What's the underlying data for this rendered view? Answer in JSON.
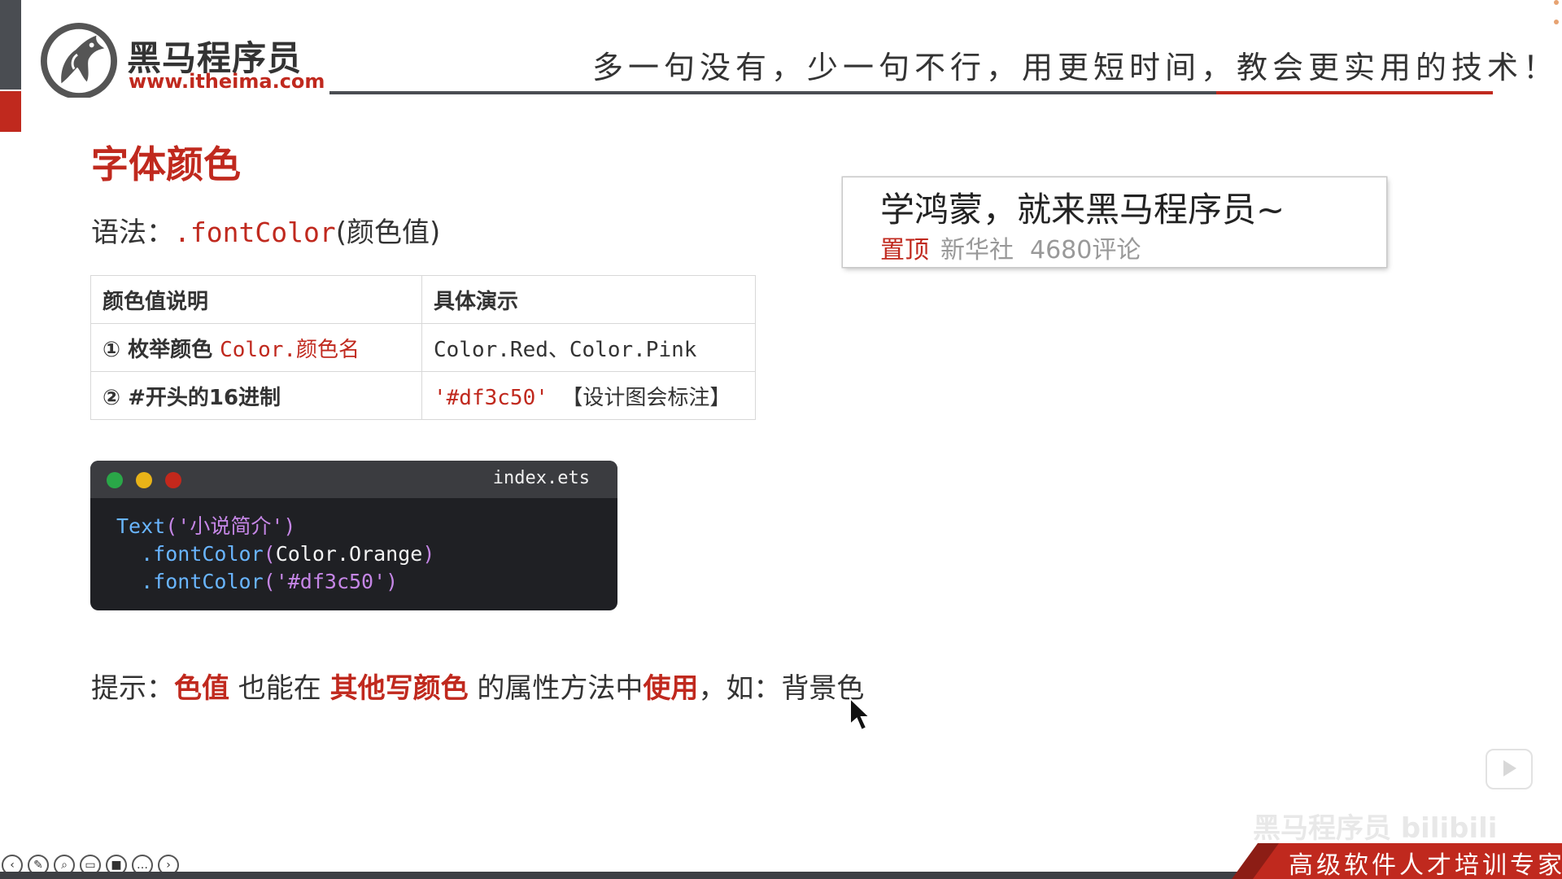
{
  "header": {
    "logo_cn": "黑马程序员",
    "logo_url": "www.itheima.com",
    "slogan": "多一句没有，少一句不行，用更短时间，教会更实用的技术！"
  },
  "slide": {
    "title": "字体颜色",
    "syntax_label": "语法：",
    "syntax_code": ".fontColor",
    "syntax_arg": "(颜色值)",
    "table": {
      "headers": [
        "颜色值说明",
        "具体演示"
      ],
      "rows": [
        {
          "label": "① 枚举颜色 ",
          "label_code": "Color.颜色名",
          "demo_code": "Color.Red、Color.Pink",
          "demo_note": ""
        },
        {
          "label": "② #开头的16进制",
          "label_code": "",
          "demo_code": "'#df3c50'",
          "demo_note": "【设计图会标注】"
        }
      ]
    },
    "code_window": {
      "filename": "index.ets",
      "lines": [
        {
          "fn": "Text",
          "open": "(",
          "str": "'小说简介'",
          "close": ")"
        },
        {
          "indent": "  ",
          "fn": ".fontColor",
          "open": "(",
          "arg": "Color.Orange",
          "close": ")"
        },
        {
          "indent": "  ",
          "fn": ".fontColor",
          "open": "(",
          "str": "'#df3c50'",
          "close": ")"
        }
      ]
    },
    "tip": {
      "p1": "提示：",
      "h1": "色值",
      "p2": " 也能在 ",
      "h2": "其他写颜色",
      "p3": " 的属性方法中",
      "h3": "使用",
      "p4": "，如：背景色"
    },
    "news_card": {
      "title": "学鸿蒙，就来黑马程序员~",
      "top_tag": "置顶",
      "source": "新华社",
      "comments": "4680评论"
    }
  },
  "footer": {
    "tagline": "高级软件人才培训专家",
    "watermark": "黑马程序员 bilibili"
  },
  "colors": {
    "brand_red": "#c0291e",
    "dark_gray": "#4a4d52",
    "code_bg": "#1f2024"
  }
}
